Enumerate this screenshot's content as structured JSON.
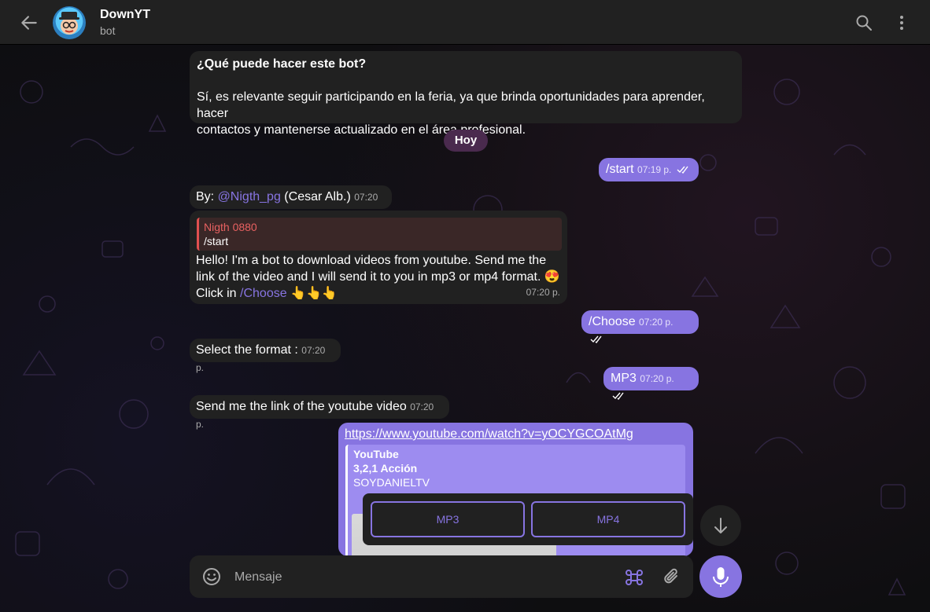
{
  "header": {
    "title": "DownYT",
    "status": "bot",
    "back_icon": "arrow-left-icon",
    "search_icon": "search-icon",
    "more_icon": "more-vertical-icon"
  },
  "intro": {
    "title": "¿Qué puede hacer este bot?",
    "line1": "Sí, es relevante seguir participando en la feria, ya que brinda oportunidades para aprender, hacer",
    "line2": "contactos y mantenerse actualizado en el área profesional."
  },
  "date_chip": "Hoy",
  "messages": {
    "m1": {
      "text": "/start",
      "time": "07:19 p."
    },
    "m2": {
      "prefix": "By: ",
      "mention": "@Nigth_pg",
      "suffix": " (Cesar Alb.)",
      "time": "07:20 p."
    },
    "m3": {
      "reply_name": "Nigth 0880",
      "reply_text": "/start",
      "line1": "Hello! I'm a bot to download videos from youtube. Send me the",
      "line2": "link of the video and I will send it to you in mp3 or mp4 format. 😍",
      "line3_prefix": "Click in ",
      "line3_link": "/Choose",
      "line3_suffix": " 👆👆👆",
      "time": "07:20 p."
    },
    "m4": {
      "text": "/Choose",
      "time": "07:20 p."
    },
    "m5": {
      "text": "Select the format : ",
      "time": "07:20 p."
    },
    "m6": {
      "text": "MP3",
      "time": "07:20 p."
    },
    "m7": {
      "text": "Send me the link of the youtube video ",
      "time": "07:20 p."
    },
    "m8": {
      "url": "https://www.youtube.com/watch?v=yOCYGCOAtMg",
      "site": "YouTube",
      "title": "3,2,1 Acción",
      "channel": "SOYDANIELTV"
    }
  },
  "keyboard": {
    "button1": "MP3",
    "button2": "MP4"
  },
  "composer": {
    "placeholder": "Mensaje",
    "emoji_icon": "emoji-icon",
    "commands_icon": "command-icon",
    "attach_icon": "paperclip-icon",
    "mic_icon": "microphone-icon"
  },
  "colors": {
    "accent": "#8774e1",
    "header_bg": "#212121",
    "incoming_bubble": "#212121",
    "outgoing_bubble": "#8774e1",
    "date_chip": "#4a2a4e",
    "reply_bar": "#e15050"
  }
}
